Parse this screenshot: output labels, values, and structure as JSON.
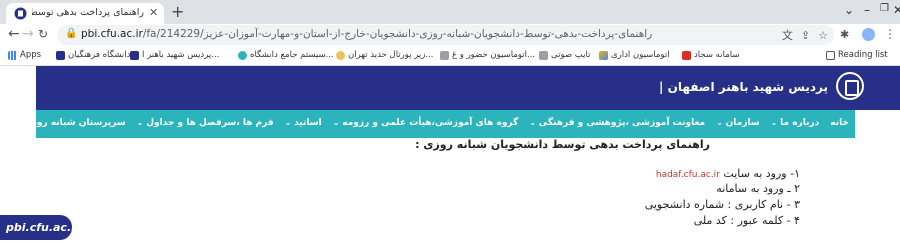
{
  "browser": {
    "tab_title": "راهنمای پرداخت بدهی توسط دانشجویان",
    "url_host": "pbi.cfu.ac.ir",
    "url_path": "/fa/214229/راهنمای-پرداخت-بدهی-توسط-دانشجویان-شبانه-روزی-دانشجویان-خارج-از-استان-و-مهارت-آموزان-عزیز",
    "reading_list": "Reading list",
    "bookmarks": [
      "Apps",
      "دانشگاه فرهنگیان",
      "پردیس شهید باهنر ا...",
      "سیستم جامع دانشگاه...",
      "زیر پورتال حدید تهران...",
      "اتوماسیون حضور و غ...",
      "تایپ صوتی",
      "اتوماسیون اداری",
      "سامانه سجاد"
    ],
    "colors": {
      "tabstrip": "#dee1e6",
      "omnibox": "#f1f3f4"
    }
  },
  "site": {
    "title": "پردیس شهید باهنر اصفهان |",
    "header_color": "#263088",
    "nav_color": "#2bb4bc",
    "nav_items": [
      "خانه",
      "درباره ما",
      "سازمان",
      "معاونت آموزشی ،پژوهشی و فرهنگی",
      "گروه های آموزشی،هیأت علمی و رزومه",
      "اساتید",
      "فرم ها ،سرفصل ها و جداول",
      "سرپرستان شبانه روزی پردیس"
    ],
    "content": {
      "heading": "راهنمای پرداخت بدهی توسط دانشجویان شبانه روزی :",
      "step1_prefix": "۱- ورود به سایت",
      "step1_link": "hadaf.cfu.ac.ir",
      "step2": "۲ ـ ورود به سامانه",
      "step3": "۳ - نام کاربری : شماره دانشجویی",
      "step4": "۴ - کلمه عبور : کد ملی"
    },
    "footer_brand": "pbi.cfu.ac.ir"
  }
}
